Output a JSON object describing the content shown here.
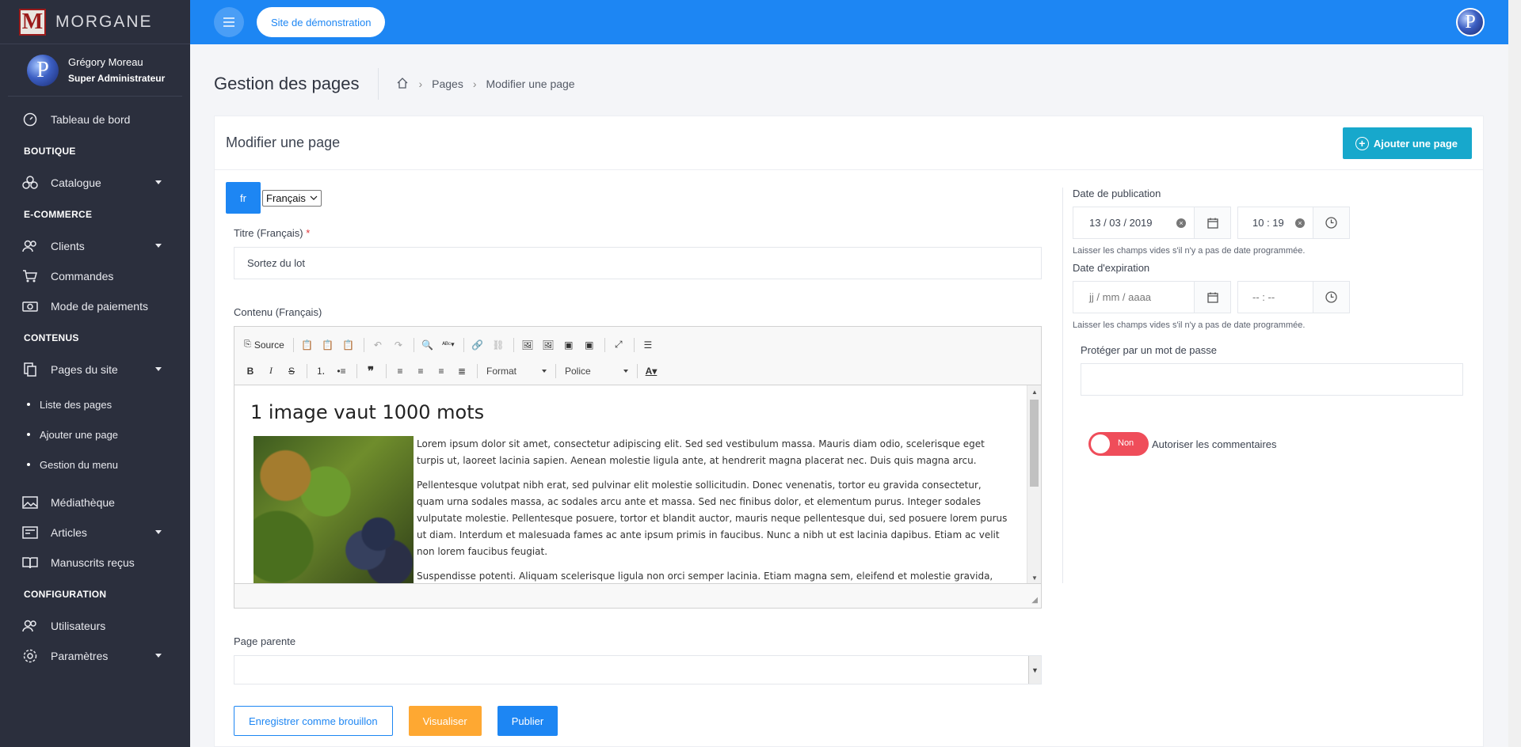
{
  "brand": {
    "logo_letter": "M",
    "name": "MORGANE"
  },
  "user": {
    "avatar_letter": "P",
    "name": "Grégory Moreau",
    "role": "Super Administrateur"
  },
  "sidebar": {
    "dashboard": "Tableau de bord",
    "section_boutique": "BOUTIQUE",
    "catalogue": "Catalogue",
    "section_ecommerce": "E-COMMERCE",
    "clients": "Clients",
    "commandes": "Commandes",
    "paiements": "Mode de paiements",
    "section_contenus": "CONTENUS",
    "pages": "Pages du site",
    "sub_liste": "Liste des pages",
    "sub_ajouter": "Ajouter une page",
    "sub_menu": "Gestion du menu",
    "mediatheque": "Médiathèque",
    "articles": "Articles",
    "manuscrits": "Manuscrits reçus",
    "section_config": "CONFIGURATION",
    "utilisateurs": "Utilisateurs",
    "parametres": "Paramètres"
  },
  "topbar": {
    "site_label": "Site de démonstration",
    "avatar_letter": "P"
  },
  "header": {
    "title": "Gestion des pages",
    "crumb_pages": "Pages",
    "crumb_current": "Modifier une page"
  },
  "card": {
    "title": "Modifier une page",
    "add_button": "Ajouter une page"
  },
  "lang": {
    "code": "fr",
    "selected": "Français"
  },
  "form": {
    "title_label": "Titre (Français)",
    "required_mark": "*",
    "title_value": "Sortez du lot",
    "content_label": "Contenu (Français)",
    "parent_label": "Page parente"
  },
  "editor": {
    "source_label": "Source",
    "format_label": "Format",
    "font_label": "Police",
    "heading": "1 image vaut 1000 mots",
    "paragraphs": [
      "Lorem ipsum dolor sit amet, consectetur adipiscing elit. Sed sed vestibulum massa. Mauris diam odio, scelerisque eget turpis ut, laoreet lacinia sapien. Aenean molestie ligula ante, at hendrerit magna placerat nec. Duis quis magna arcu.",
      "Pellentesque volutpat nibh erat, sed pulvinar elit molestie sollicitudin. Donec venenatis, tortor eu gravida consectetur, quam urna sodales massa, ac sodales arcu ante et massa. Sed nec finibus dolor, et elementum purus. Integer sodales vulputate molestie. Pellentesque posuere, tortor et blandit auctor, mauris neque pellentesque dui, sed posuere lorem purus ut diam. Interdum et malesuada fames ac ante ipsum primis in faucibus. Nunc a nibh ut est lacinia dapibus. Etiam ac velit non lorem faucibus feugiat.",
      "Suspendisse potenti. Aliquam scelerisque ligula non orci semper lacinia. Etiam magna sem, eleifend et molestie gravida, semper non sem. Interdum et malesuada fames ac ante ipsum primis in faucibus. Nullam lorem est, luctus nec cursus at, mollis ac arcu."
    ]
  },
  "publication": {
    "pub_label": "Date de publication",
    "pub_date": "13 / 03 / 2019",
    "pub_time": "10 : 19",
    "hint": "Laisser les champs vides s'il n'y a pas de date programmée.",
    "exp_label": "Date d'expiration",
    "exp_date_placeholder": "jj / mm / aaaa",
    "exp_time_placeholder": "-- : --",
    "password_label": "Protéger par un mot de passe",
    "toggle_state": "Non",
    "comments_label": "Autoriser les commentaires"
  },
  "actions": {
    "draft": "Enregistrer comme brouillon",
    "preview": "Visualiser",
    "publish": "Publier"
  },
  "colors": {
    "primary": "#1d86f3",
    "sidebar": "#2b2f3d",
    "info": "#17a8cc",
    "warning": "#fea832",
    "danger": "#ef4d5a"
  },
  "icons": {
    "dashboard": "dashboard-gauge-icon",
    "catalogue": "boxes-icon",
    "clients": "users-icon",
    "commandes": "cart-icon",
    "paiements": "money-icon",
    "pages": "pages-icon",
    "mediatheque": "image-icon",
    "articles": "articles-icon",
    "manuscrits": "book-icon",
    "utilisateurs": "users-icon",
    "parametres": "gear-icon"
  }
}
